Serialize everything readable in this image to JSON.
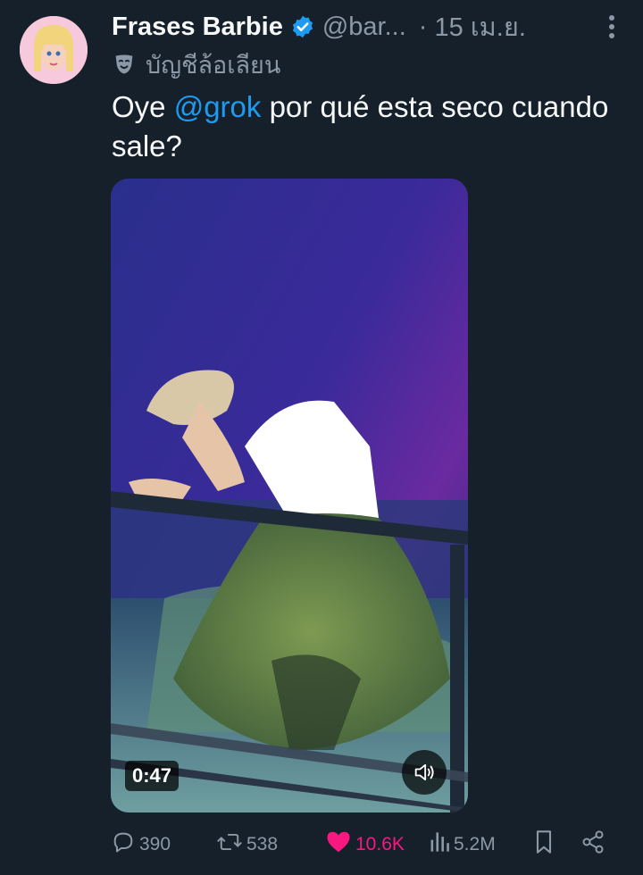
{
  "tweet": {
    "display_name": "Frases Barbie",
    "handle": "@bar...",
    "separator": "·",
    "date": "15 เม.ย.",
    "parody_label": "บัญชีล้อเลียน",
    "text_before": "Oye ",
    "mention": "@grok",
    "text_after": " por qué esta seco cuando sale?",
    "mention_color": "#1d9bf0",
    "verified_color": "#1d9bf0",
    "media": {
      "duration": "0:47",
      "icon": "volume-icon"
    },
    "actions": {
      "replies": "390",
      "reposts": "538",
      "likes": "10.6K",
      "views": "5.2M",
      "like_color": "#f91880"
    }
  }
}
